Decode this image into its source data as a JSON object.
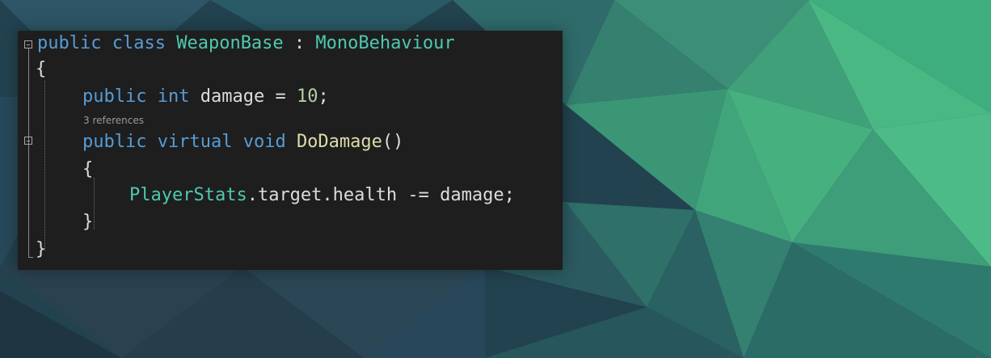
{
  "code": {
    "line1": {
      "kw1": "public",
      "kw2": "class",
      "name": "WeaponBase",
      "colon": ":",
      "base": "MonoBehaviour"
    },
    "line2": {
      "brace": "{"
    },
    "line3": {
      "kw1": "public",
      "kw2": "int",
      "rest": "damage = ",
      "num": "10",
      "semi": ";"
    },
    "references": "3 references",
    "line4": {
      "kw1": "public",
      "kw2": "virtual",
      "kw3": "void",
      "method": "DoDamage",
      "parens": "()"
    },
    "line5": {
      "brace": "{"
    },
    "line6": {
      "type": "PlayerStats",
      "rest": ".target.health -= damage;"
    },
    "line7": {
      "brace": "}"
    },
    "line8": {
      "brace": "}"
    }
  },
  "colors": {
    "keyword": "#569cd6",
    "type": "#4ec9b0",
    "method": "#dcdcaa",
    "number": "#b5cea8",
    "editor_background": "#1e1e1e"
  },
  "icons": [
    "collapse-class-icon",
    "collapse-method-icon"
  ]
}
